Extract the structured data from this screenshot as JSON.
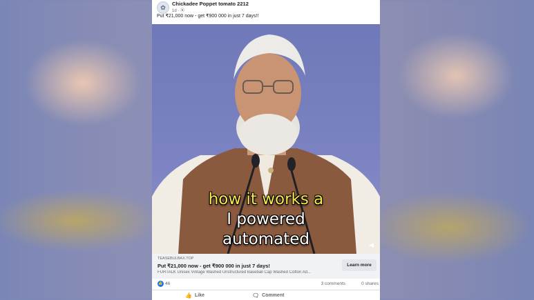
{
  "post": {
    "page_name": "Chickadee Poppet tomato 2212",
    "meta": "1d · ⦿",
    "avatar_icon": "page-avatar-icon",
    "caption": "Put ₹21,000 now - get ₹900 000 in just 7 days!!"
  },
  "video": {
    "subtitle_line1": "how it works a",
    "subtitle_line2": "I powered",
    "subtitle_line3": "automated",
    "volume_icon": "speaker-icon"
  },
  "ad": {
    "domain": "TEASEBULBAX.TOP",
    "title": "Put ₹21,000 now - get ₹900 000 in just 7 days!",
    "description": "FURTALK Unisex Vintage Washed Unstructured Baseball Cap Washed Cotton Ad...",
    "cta_label": "Learn more"
  },
  "stats": {
    "likes": "46",
    "comments": "3 comments",
    "shares": "0 shares"
  },
  "actions": {
    "like_label": "Like",
    "comment_label": "Comment"
  },
  "colors": {
    "accent": "#1877f2",
    "subtitle_yellow": "#f4e94a",
    "card_bg": "#ffffff",
    "ad_bar_bg": "#f0f2f5"
  }
}
